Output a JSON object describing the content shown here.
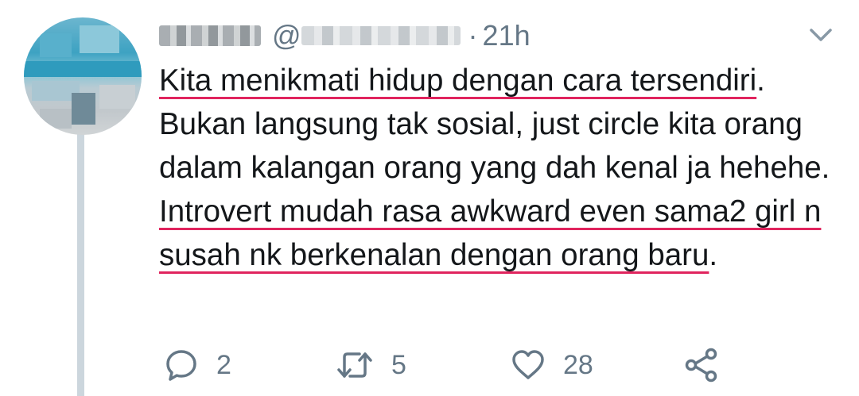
{
  "tweet": {
    "display_name": "",
    "handle_prefix": "@",
    "dot": "·",
    "time": "21h",
    "text_segments": [
      {
        "text": "Kita menikmati hidup dengan cara tersendiri",
        "underline": true
      },
      {
        "text": ". Bukan langsung tak sosial, just circle kita orang dalam kalangan orang yang dah kenal ja hehehe. ",
        "underline": false
      },
      {
        "text": "Introvert mudah rasa awkward even sama2 girl n susah nk berkenalan dengan orang baru",
        "underline": true
      },
      {
        "text": ".",
        "underline": false
      }
    ]
  },
  "actions": {
    "reply_count": "2",
    "retweet_count": "5",
    "like_count": "28"
  },
  "icons": {
    "reply": "reply-icon",
    "retweet": "retweet-icon",
    "like": "heart-icon",
    "share": "share-icon",
    "caret": "chevron-down-icon"
  },
  "colors": {
    "text": "#14171a",
    "muted": "#657786",
    "underline": "#e0245e",
    "thread_line": "#ccd6dd"
  }
}
